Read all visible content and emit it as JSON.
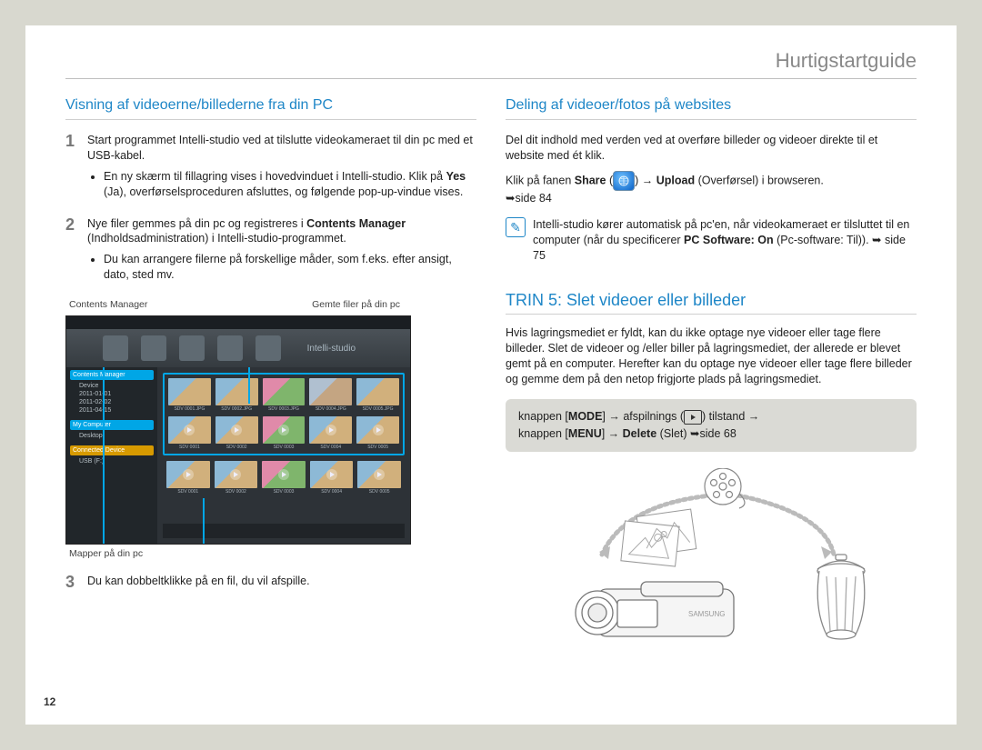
{
  "header": "Hurtigstartguide",
  "page_number": "12",
  "left": {
    "title": "Visning af videoerne/billederne fra din PC",
    "steps": {
      "s1_text": "Start programmet Intelli-studio ved at tilslutte videokameraet til din pc med et USB-kabel.",
      "s1_bullet_pre": "En ny skærm til fillagring vises i hovedvinduet i Intelli-studio. Klik på ",
      "s1_bullet_yes": "Yes",
      "s1_bullet_post": " (Ja), overførselsproceduren afsluttes, og følgende pop-up-vindue vises.",
      "s2_pre": "Nye filer gemmes på din pc og registreres i ",
      "s2_bold": "Contents Manager",
      "s2_post": " (Indholdsadministration) i Intelli-studio-programmet.",
      "s2_bullet": "Du kan arrangere filerne på forskellige måder, som f.eks. efter ansigt, dato, sted mv.",
      "label_contents": "Contents Manager",
      "label_saved": "Gemte filer på din pc",
      "label_maps": "Mapper på din pc",
      "s3_text": "Du kan dobbeltklikke på en fil, du vil afspille."
    },
    "screenshot": {
      "logo": "Intelli-studio",
      "sidebar": {
        "contents": "Contents Manager",
        "device": "Device",
        "dates": [
          "2011-01-01",
          "2011-02-02",
          "2011-04-15"
        ],
        "mycomputer": "My Computer",
        "desktop": "Desktop",
        "connected": "Connected Device",
        "usb": "USB (F:)"
      }
    }
  },
  "right": {
    "title": "Deling af videoer/fotos på websites",
    "p1": "Del dit indhold med verden ved at overføre billeder og videoer direkte til et website med ét klik.",
    "share_pre": "Klik på fanen ",
    "share_bold": "Share",
    "share_mid": " (",
    "share_arrow": "→",
    "share_upload": "Upload",
    "share_post": " (Overførsel) i browseren.",
    "share_ref_arrow": "➥",
    "share_ref": "side 84",
    "note_pre": "Intelli-studio kører automatisk på pc'en, når videokameraet er tilsluttet til en computer (når du specificerer ",
    "note_bold1": "PC Software: On",
    "note_mid": " (Pc-software: Til)). ",
    "note_arrow": "➥",
    "note_ref": " side 75",
    "trin5_title": "TRIN 5: Slet videoer eller billeder",
    "trin5_body": "Hvis lagringsmediet er fyldt, kan du ikke optage nye videoer eller tage flere billeder. Slet de videoer og /eller biller på lagringsmediet, der allerede er blevet gemt på en computer. Herefter kan du optage nye videoer eller tage flere billeder og gemme dem på den netop frigjorte plads på lagringsmediet.",
    "gray": {
      "pre1": "knappen [",
      "mode": "MODE",
      "mid1": "] → afspilnings (",
      "mid2": ") tilstand →",
      "pre2": "knappen [",
      "menu": "MENU",
      "mid3": "] → ",
      "delete": "Delete",
      "post": " (Slet) ",
      "arrow": "➥",
      "ref": "side 68"
    }
  }
}
